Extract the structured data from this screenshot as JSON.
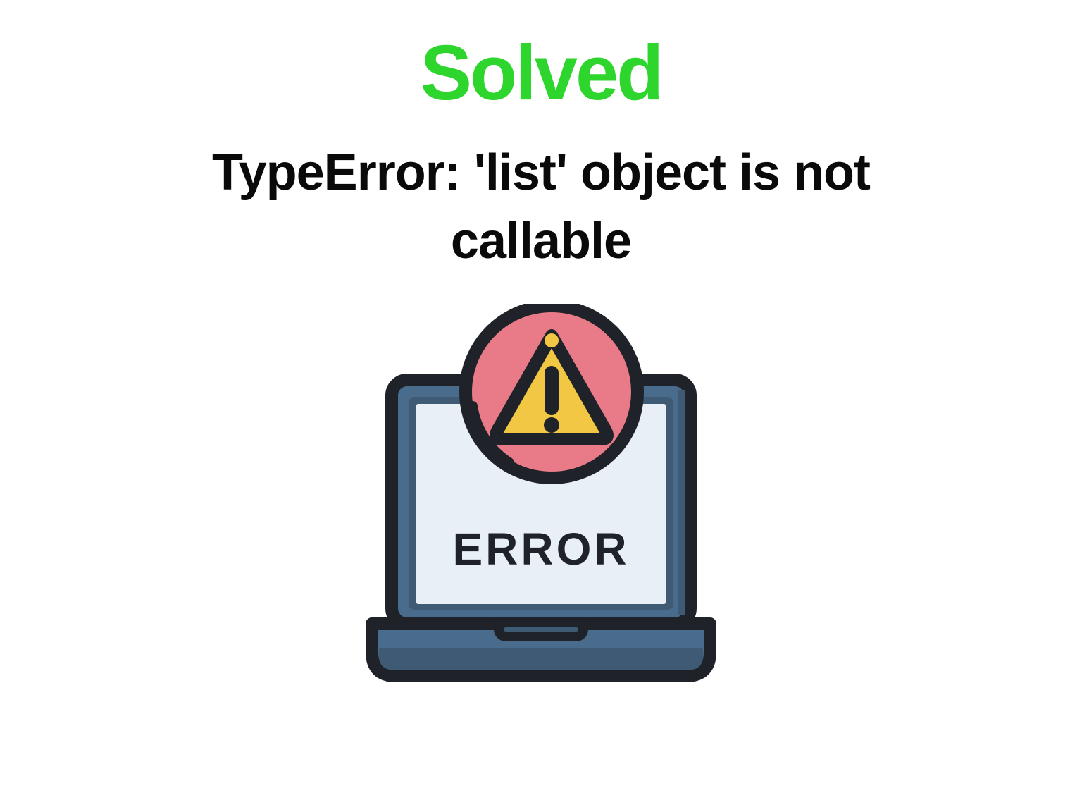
{
  "heading": {
    "status": "Solved",
    "error_message": "TypeError: 'list' object is not callable"
  },
  "illustration": {
    "screen_text": "ERROR",
    "colors": {
      "status_green": "#2dd52d",
      "text_black": "#0a0a0a",
      "laptop_body": "#4a6c8c",
      "laptop_body_dark": "#3e5a74",
      "screen_bg": "#e8eff6",
      "warning_circle": "#e87b87",
      "warning_triangle": "#f2c744",
      "outline": "#1f2329"
    }
  }
}
